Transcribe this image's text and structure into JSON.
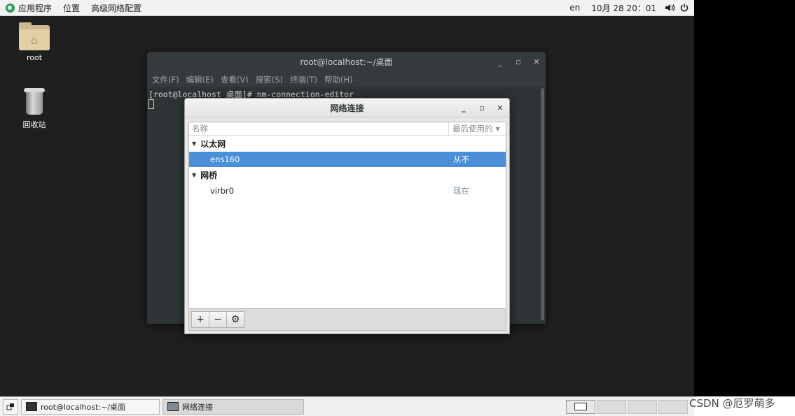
{
  "topbar": {
    "apps_label": "应用程序",
    "places_label": "位置",
    "app_menu_label": "高级网络配置",
    "lang": "en",
    "datetime": "10月 28 20：01"
  },
  "desktop": {
    "home_label": "root",
    "trash_label": "回收站"
  },
  "terminal": {
    "title": "root@localhost:~/桌面",
    "menu": [
      "文件(F)",
      "编辑(E)",
      "查看(V)",
      "搜索(S)",
      "终端(T)",
      "帮助(H)"
    ],
    "line1": "[root@localhost 桌面]# nm-connection-editor"
  },
  "network_dialog": {
    "title": "网络连接",
    "col_name": "名称",
    "col_last_used": "最后使用的",
    "groups": [
      {
        "label": "以太网",
        "items": [
          {
            "name": "ens160",
            "last_used": "从不",
            "selected": true
          }
        ]
      },
      {
        "label": "网桥",
        "items": [
          {
            "name": "virbr0",
            "last_used": "现在",
            "selected": false
          }
        ]
      }
    ],
    "add_glyph": "+",
    "remove_glyph": "−",
    "settings_glyph": "⚙"
  },
  "taskbar": {
    "task1": "root@localhost:~/桌面",
    "task2": "网络连接"
  },
  "watermark": "CSDN @厄罗萌多",
  "colors": {
    "selection": "#4a90d9",
    "terminal_bg": "#2e3436"
  }
}
